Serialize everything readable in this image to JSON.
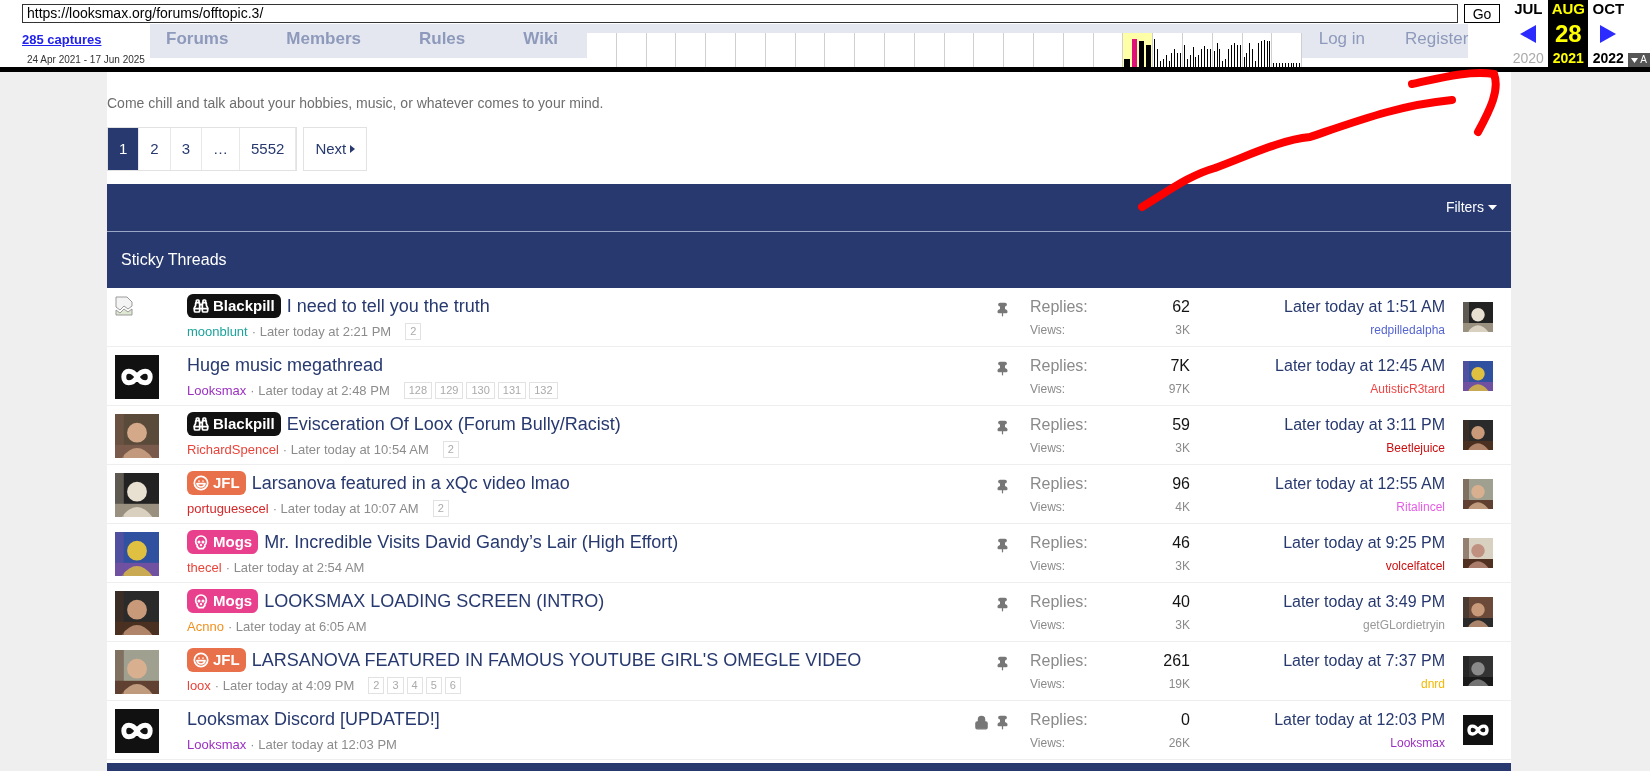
{
  "toolbar": {
    "url": "https://looksmax.org/forums/offtopic.3/",
    "go_label": "Go",
    "captures": "285 captures",
    "date_range": "24 Apr 2021 - 17 Jun 2025",
    "toggle_label": "A",
    "months": [
      {
        "label": "JUL",
        "year": "2020",
        "year_active": false,
        "selected": false
      },
      {
        "label": "AUG",
        "day": "28",
        "year": "2021",
        "year_active": true,
        "selected": true
      },
      {
        "label": "OCT",
        "year": "2022",
        "year_active": true,
        "selected": false
      }
    ]
  },
  "site_nav": {
    "items": [
      "Forums",
      "Members",
      "Rules",
      "Wiki"
    ],
    "account": [
      "Log in",
      "Register"
    ]
  },
  "forum": {
    "description": "Come chill and talk about your hobbies, music, or whatever comes to your mind.",
    "pages": [
      {
        "label": "1",
        "selected": true
      },
      {
        "label": "2",
        "selected": false
      },
      {
        "label": "3",
        "selected": false
      },
      {
        "label": "…",
        "selected": false
      },
      {
        "label": "5552",
        "selected": false
      }
    ],
    "next_label": "Next",
    "filters_label": "Filters",
    "section_title": "Sticky Threads"
  },
  "threads": [
    {
      "avatar": {
        "kind": "broken"
      },
      "prefix": {
        "kind": "blackpill",
        "label": "Blackpill"
      },
      "title": "I need to tell you the truth",
      "author": {
        "name": "moonblunt",
        "color": "#1ba39c"
      },
      "time": "· Later today at 2:21 PM",
      "pages": [
        "2"
      ],
      "locked": false,
      "pinned": true,
      "replies_label": "Replies:",
      "replies": "62",
      "views_label": "Views:",
      "views": "3K",
      "last_time": "Later today at 1:51 AM",
      "last_poster": {
        "name": "redpilledalpha",
        "color": "#5565d0"
      },
      "last_avatar": {
        "kind": "picture"
      }
    },
    {
      "avatar": {
        "kind": "logo"
      },
      "title": "Huge music megathread",
      "author": {
        "name": "Looksmax",
        "color": "#9b30c0"
      },
      "time": "· Later today at 2:48 PM",
      "pages": [
        "128",
        "129",
        "130",
        "131",
        "132"
      ],
      "locked": false,
      "pinned": true,
      "replies_label": "Replies:",
      "replies": "7K",
      "views_label": "Views:",
      "views": "97K",
      "last_time": "Later today at 12:45 AM",
      "last_poster": {
        "name": "AutisticR3tard",
        "color": "#f04545"
      },
      "last_avatar": {
        "kind": "picture"
      }
    },
    {
      "avatar": {
        "kind": "picture"
      },
      "prefix": {
        "kind": "blackpill",
        "label": "Blackpill"
      },
      "title": "Evisceration Of Loox (Forum Bully/Racist)",
      "author": {
        "name": "RichardSpencel",
        "color": "#e8443a"
      },
      "time": "· Later today at 10:54 AM",
      "pages": [
        "2"
      ],
      "locked": false,
      "pinned": true,
      "replies_label": "Replies:",
      "replies": "59",
      "views_label": "Views:",
      "views": "3K",
      "last_time": "Later today at 3:11 PM",
      "last_poster": {
        "name": "Beetlejuice",
        "color": "#cc1010"
      },
      "last_avatar": {
        "kind": "picture"
      }
    },
    {
      "avatar": {
        "kind": "picture"
      },
      "prefix": {
        "kind": "jfl",
        "label": "JFL"
      },
      "title": "Larsanova featured in a xQc video lmao",
      "author": {
        "name": "portuguesecel",
        "color": "#d4282a"
      },
      "time": "· Later today at 10:07 AM",
      "pages": [
        "2"
      ],
      "locked": false,
      "pinned": true,
      "replies_label": "Replies:",
      "replies": "96",
      "views_label": "Views:",
      "views": "4K",
      "last_time": "Later today at 12:55 AM",
      "last_poster": {
        "name": "Ritalincel",
        "color": "#e65ce6"
      },
      "last_avatar": {
        "kind": "picture"
      }
    },
    {
      "avatar": {
        "kind": "picture"
      },
      "prefix": {
        "kind": "mogs",
        "label": "Mogs"
      },
      "title": "Mr. Incredible Visits David Gandy’s Lair (High Effort)",
      "author": {
        "name": "thecel",
        "color": "#e8443a"
      },
      "time": "· Later today at 2:54 AM",
      "locked": false,
      "pinned": true,
      "replies_label": "Replies:",
      "replies": "46",
      "views_label": "Views:",
      "views": "3K",
      "last_time": "Later today at 9:25 PM",
      "last_poster": {
        "name": "volcelfatcel",
        "color": "#cc1010"
      },
      "last_avatar": {
        "kind": "picture"
      }
    },
    {
      "avatar": {
        "kind": "picture"
      },
      "prefix": {
        "kind": "mogs",
        "label": "Mogs"
      },
      "title": "LOOKSMAX LOADING SCREEN (INTRO)",
      "author": {
        "name": "Acnno",
        "color": "#f0901e"
      },
      "time": "· Later today at 6:05 AM",
      "locked": false,
      "pinned": true,
      "replies_label": "Replies:",
      "replies": "40",
      "views_label": "Views:",
      "views": "3K",
      "last_time": "Later today at 3:49 PM",
      "last_poster": {
        "name": "getGLordietryin",
        "color": "#999999"
      },
      "last_avatar": {
        "kind": "picture"
      }
    },
    {
      "avatar": {
        "kind": "picture"
      },
      "prefix": {
        "kind": "jfl",
        "label": "JFL"
      },
      "title": "LARSANOVA FEATURED IN FAMOUS YOUTUBE GIRL'S OMEGLE VIDEO",
      "author": {
        "name": "loox",
        "color": "#e8443a"
      },
      "time": "· Later today at 4:09 PM",
      "pages": [
        "2",
        "3",
        "4",
        "5",
        "6"
      ],
      "locked": false,
      "pinned": true,
      "replies_label": "Replies:",
      "replies": "261",
      "views_label": "Views:",
      "views": "19K",
      "last_time": "Later today at 7:37 PM",
      "last_poster": {
        "name": "dnrd",
        "color": "#f5b800"
      },
      "last_avatar": {
        "kind": "picture"
      }
    },
    {
      "avatar": {
        "kind": "logo"
      },
      "title": "Looksmax Discord [UPDATED!]",
      "author": {
        "name": "Looksmax",
        "color": "#9b30c0"
      },
      "time": "· Later today at 12:03 PM",
      "locked": true,
      "pinned": true,
      "replies_label": "Replies:",
      "replies": "0",
      "views_label": "Views:",
      "views": "26K",
      "last_time": "Later today at 12:03 PM",
      "last_poster": {
        "name": "Looksmax",
        "color": "#9b30c0"
      },
      "last_avatar": {
        "kind": "logo"
      }
    }
  ]
}
